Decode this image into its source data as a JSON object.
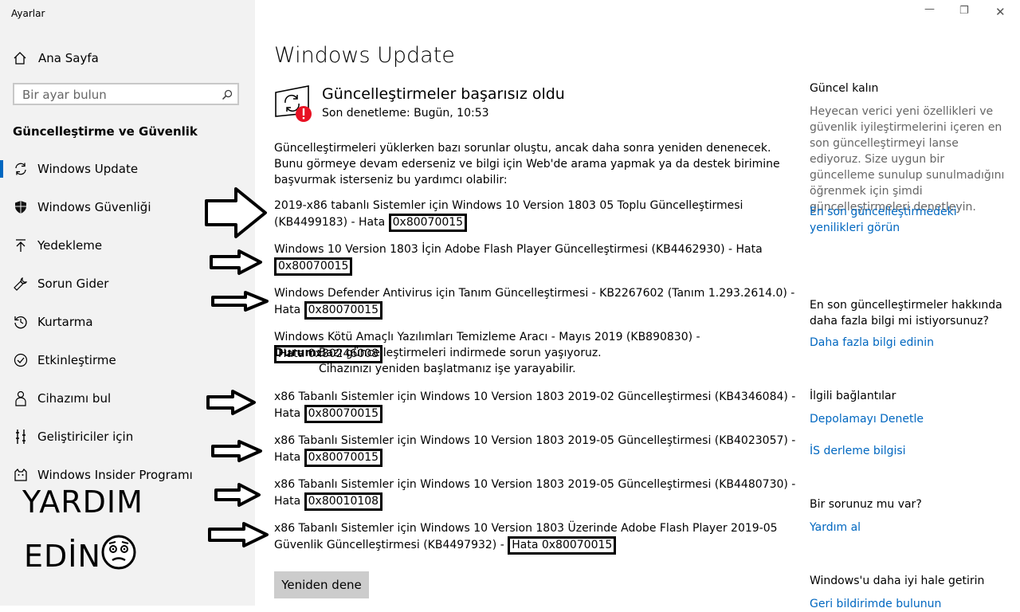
{
  "window": {
    "app_title": "Ayarlar"
  },
  "sidebar": {
    "home_label": "Ana Sayfa",
    "search_placeholder": "Bir ayar bulun",
    "section_title": "Güncelleştirme ve Güvenlik",
    "items": [
      {
        "label": "Windows Update",
        "icon": "sync-icon"
      },
      {
        "label": "Windows Güvenliği",
        "icon": "shield-icon"
      },
      {
        "label": "Yedekleme",
        "icon": "backup-arrow-icon"
      },
      {
        "label": "Sorun Gider",
        "icon": "wrench-icon"
      },
      {
        "label": "Kurtarma",
        "icon": "recovery-icon"
      },
      {
        "label": "Etkinleştirme",
        "icon": "check-circle-icon"
      },
      {
        "label": "Cihazımı bul",
        "icon": "person-pin-icon"
      },
      {
        "label": "Geliştiriciler için",
        "icon": "developer-icon"
      },
      {
        "label": "Windows Insider Programı",
        "icon": "insider-cat-icon"
      }
    ]
  },
  "overlay": {
    "line1": "YARDIM",
    "line2": "EDİN"
  },
  "main": {
    "title": "Windows Update",
    "status_title": "Güncelleştirmeler başarısız oldu",
    "status_sub": "Son denetleme: Bugün, 10:53",
    "intro": "Güncelleştirmeleri yüklerken bazı sorunlar oluştu, ancak daha sonra yeniden denenecek. Bunu görmeye devam ederseniz ve bilgi için Web'de arama yapmak ya da destek birimine başvurmak isterseniz bu yardımcı olabilir:",
    "updates": [
      {
        "text": "2019-x86 tabanlı Sistemler için Windows 10 Version 1803 05 Toplu Güncelleştirmesi (KB4499183) - Hata ",
        "code": "0x80070015"
      },
      {
        "text": "Windows 10 Version 1803 İçin Adobe Flash Player Güncelleştirmesi (KB4462930) - Hata ",
        "code": "0x80070015"
      },
      {
        "text": "Windows Defender Antivirus için Tanım Güncelleştirmesi - KB2267602 (Tanım 1.293.2614.0) - Hata ",
        "code": "0x80070015"
      },
      {
        "text": "Windows Kötü Amaçlı Yazılımları Temizleme Aracı - Mayıs 2019 (KB890830) - ",
        "code": "Hata 0x80246008"
      },
      {
        "text": "x86 Tabanlı Sistemler için Windows 10 Version 1803 2019-02 Güncelleştirmesi (KB4346084) - Hata ",
        "code": "0x80070015"
      },
      {
        "text": "x86 Tabanlı Sistemler için Windows 10 Version 1803 2019-05 Güncelleştirmesi (KB4023057) - Hata ",
        "code": "0x80070015"
      },
      {
        "text": "x86 Tabanlı Sistemler için Windows 10 Version 1803 2019-05 Güncelleştirmesi (KB4480730) - Hata ",
        "code": "0x80010108"
      },
      {
        "text": "x86 Tabanlı Sistemler için Windows 10 Version 1803 Üzerinde Adobe Flash Player 2019-05 Güvenlik Güncelleştirmesi (KB4497932) - ",
        "code": "Hata 0x80070015"
      }
    ],
    "durum_label": "Durum:",
    "durum_text": "Bazı güncelleştirmeleri indirmede sorun yaşıyoruz. Cihazınızı yeniden başlatmanız işe yarayabilir.",
    "retry_label": "Yeniden dene"
  },
  "right": {
    "s1_title": "Güncel kalın",
    "s1_text": "Heyecan verici yeni özellikleri ve güvenlik iyileştirmelerini içeren en son güncelleştirmeyi lanse ediyoruz. Size uygun bir güncelleme sunulup sunulmadığını öğrenmek için şimdi güncelleştirmeleri denetleyin.",
    "s1_link": "En son güncelleştirmedeki yenilikleri görün",
    "s2_title": "En son güncelleştirmeler hakkında daha fazla bilgi mi istiyorsunuz?",
    "s2_link": "Daha fazla bilgi edinin",
    "s3_title": "İlgili bağlantılar",
    "s3_link1": "Depolamayı Denetle",
    "s3_link2": "İS derleme bilgisi",
    "s4_title": "Bir sorunuz mu var?",
    "s4_link": "Yardım al",
    "s5_title": "Windows'u daha iyi hale getirin",
    "s5_link": "Geri bildirimde bulunun"
  },
  "colors": {
    "accent": "#0067c0",
    "sidebar_bg": "#f2f2f2",
    "error": "#e81123"
  }
}
